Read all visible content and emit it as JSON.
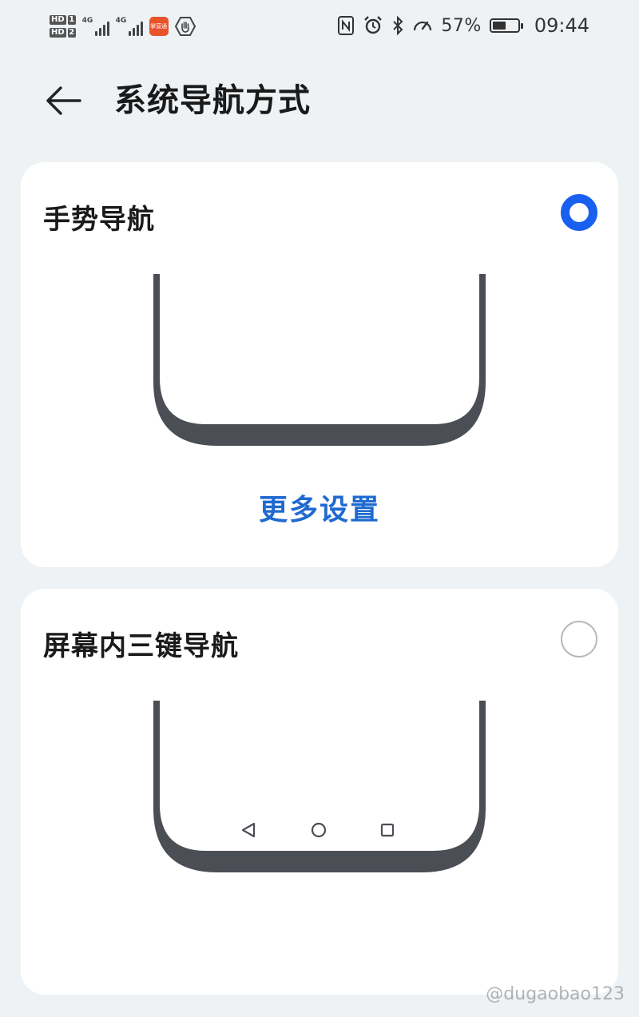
{
  "status_bar": {
    "sim1": {
      "tag": "HD",
      "num": "1"
    },
    "sim2": {
      "tag": "HD",
      "num": "2"
    },
    "network1": "4G",
    "network2": "4G",
    "app_badge": "掌营通",
    "battery_percent": "57%",
    "battery_level": 0.57,
    "time": "09:44",
    "icons": [
      "nfc-icon",
      "alarm-icon",
      "bluetooth-icon",
      "speed-icon",
      "battery-icon"
    ]
  },
  "header": {
    "title": "系统导航方式",
    "back_icon": "arrow-left-icon"
  },
  "options": [
    {
      "title": "手势导航",
      "selected": true,
      "more_settings_label": "更多设置"
    },
    {
      "title": "屏幕内三键导航",
      "selected": false,
      "nav_buttons": [
        "back-triangle-icon",
        "home-circle-icon",
        "recents-square-icon"
      ]
    }
  ],
  "colors": {
    "accent": "#1960f0",
    "link": "#1f6ad0",
    "background": "#eef2f4",
    "card": "#ffffff",
    "phone_frame": "#4b4e55"
  },
  "watermark": "@dugaobao123"
}
